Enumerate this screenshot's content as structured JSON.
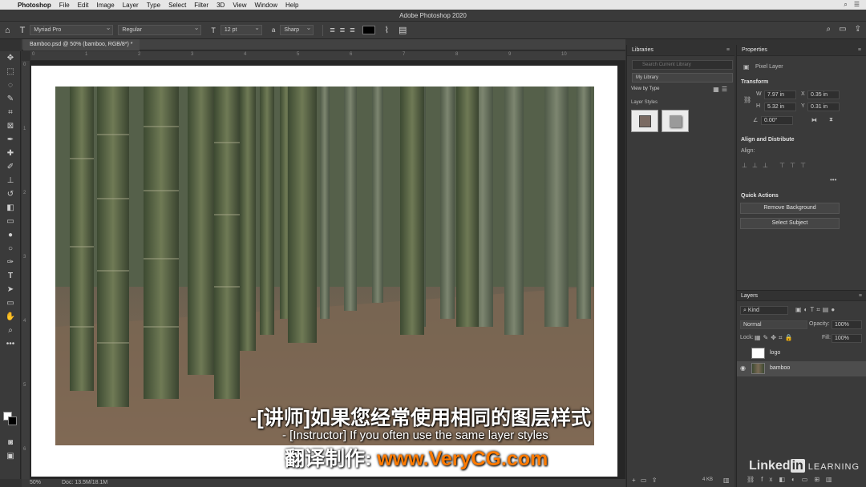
{
  "menubar": {
    "app": "Photoshop",
    "items": [
      "File",
      "Edit",
      "Image",
      "Layer",
      "Type",
      "Select",
      "Filter",
      "3D",
      "View",
      "Window",
      "Help"
    ]
  },
  "window_title": "Adobe Photoshop 2020",
  "options": {
    "font_family": "Myriad Pro",
    "font_style": "Regular",
    "font_size": "12 pt",
    "antialias": "Sharp"
  },
  "document_tab": "Bamboo.psd @ 50% (bamboo, RGB/8*) *",
  "ruler_top_ticks": [
    "0",
    "1",
    "2",
    "3",
    "4",
    "5",
    "6",
    "7",
    "8",
    "9",
    "10"
  ],
  "ruler_left_ticks": [
    "0",
    "1",
    "2",
    "3",
    "4",
    "5",
    "6"
  ],
  "status": {
    "zoom": "50%",
    "doc": "Doc: 13.5M/18.1M"
  },
  "subtitles": {
    "chinese": "-[讲师]如果您经常使用相同的图层样式",
    "english": "- [Instructor] If you often use the same layer styles",
    "credit_label": "翻译制作: ",
    "credit_site": "www.VeryCG.com"
  },
  "libraries": {
    "title": "Libraries",
    "search_placeholder": "Search Current Library",
    "library_name": "My Library",
    "view_by": "View by Type",
    "section": "Layer Styles",
    "size_label": "4 KB"
  },
  "properties": {
    "title": "Properties",
    "layer_type": "Pixel Layer",
    "transform_title": "Transform",
    "w_label": "W",
    "w_value": "7.97 in",
    "h_label": "H",
    "h_value": "5.32 in",
    "x_label": "X",
    "x_value": "0.35 in",
    "y_label": "Y",
    "y_value": "0.31 in",
    "angle": "0.00°",
    "align_title": "Align and Distribute",
    "align_label": "Align:",
    "quick_actions_title": "Quick Actions",
    "qa_remove_bg": "Remove Background",
    "qa_select_subject": "Select Subject"
  },
  "layers": {
    "title": "Layers",
    "filter_kind": "Kind",
    "blend_mode": "Normal",
    "opacity_label": "Opacity:",
    "opacity_value": "100%",
    "lock_label": "Lock:",
    "fill_label": "Fill:",
    "fill_value": "100%",
    "items": [
      {
        "name": "logo"
      },
      {
        "name": "bamboo"
      }
    ]
  },
  "watermark": {
    "brand_a": "Linked",
    "brand_b": "in",
    "brand_c": "LEARNING"
  }
}
